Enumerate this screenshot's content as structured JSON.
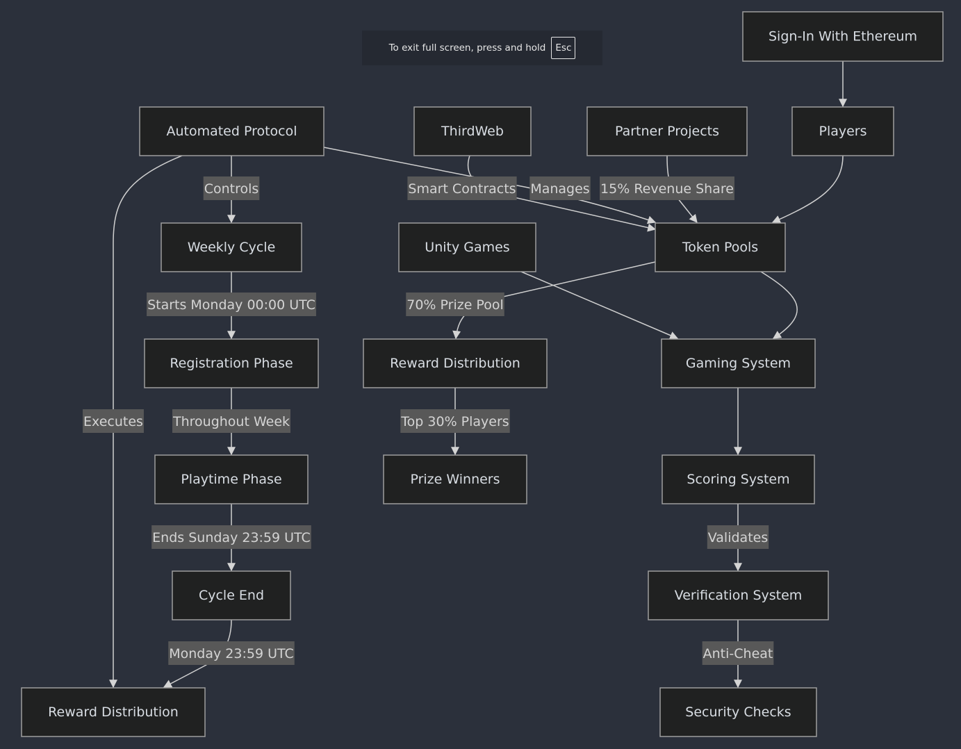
{
  "fullscreen_notice": {
    "message": "To exit full screen, press and hold",
    "key": "Esc"
  },
  "colors": {
    "background": "#2b303b",
    "node_fill": "#202121",
    "node_border": "#9e9e9e",
    "node_text": "#d8dde3",
    "edge": "#d0d0d0",
    "edge_label_bg": "#585858",
    "edge_label_text": "#d4d4d4"
  },
  "nodes": [
    {
      "id": "siwe",
      "label": "Sign-In With Ethereum"
    },
    {
      "id": "auto",
      "label": "Automated Protocol"
    },
    {
      "id": "thirdweb",
      "label": "ThirdWeb"
    },
    {
      "id": "partners",
      "label": "Partner Projects"
    },
    {
      "id": "players",
      "label": "Players"
    },
    {
      "id": "weekly",
      "label": "Weekly Cycle"
    },
    {
      "id": "unity",
      "label": "Unity Games"
    },
    {
      "id": "pools",
      "label": "Token Pools"
    },
    {
      "id": "registration",
      "label": "Registration Phase"
    },
    {
      "id": "reward_mid",
      "label": "Reward Distribution"
    },
    {
      "id": "gaming",
      "label": "Gaming System"
    },
    {
      "id": "playtime",
      "label": "Playtime Phase"
    },
    {
      "id": "winners",
      "label": "Prize Winners"
    },
    {
      "id": "scoring",
      "label": "Scoring System"
    },
    {
      "id": "cycle_end",
      "label": "Cycle End"
    },
    {
      "id": "verification",
      "label": "Verification System"
    },
    {
      "id": "reward_bottom",
      "label": "Reward Distribution"
    },
    {
      "id": "security",
      "label": "Security Checks"
    }
  ],
  "edges": [
    {
      "from": "siwe",
      "to": "players",
      "label": ""
    },
    {
      "from": "auto",
      "to": "weekly",
      "label": "Controls"
    },
    {
      "from": "auto",
      "to": "reward_bottom",
      "label": "Executes"
    },
    {
      "from": "auto",
      "to": "pools",
      "label": "Manages"
    },
    {
      "from": "thirdweb",
      "to": "pools",
      "label": "Smart Contracts"
    },
    {
      "from": "partners",
      "to": "pools",
      "label": "15% Revenue Share"
    },
    {
      "from": "players",
      "to": "pools",
      "label": ""
    },
    {
      "from": "weekly",
      "to": "registration",
      "label": "Starts Monday 00:00 UTC"
    },
    {
      "from": "pools",
      "to": "reward_mid",
      "label": "70% Prize Pool"
    },
    {
      "from": "unity",
      "to": "gaming",
      "label": ""
    },
    {
      "from": "pools",
      "to": "gaming",
      "label": ""
    },
    {
      "from": "registration",
      "to": "playtime",
      "label": "Throughout Week"
    },
    {
      "from": "reward_mid",
      "to": "winners",
      "label": "Top 30% Players"
    },
    {
      "from": "gaming",
      "to": "scoring",
      "label": ""
    },
    {
      "from": "playtime",
      "to": "cycle_end",
      "label": "Ends Sunday 23:59 UTC"
    },
    {
      "from": "scoring",
      "to": "verification",
      "label": "Validates"
    },
    {
      "from": "cycle_end",
      "to": "reward_bottom",
      "label": "Monday 23:59 UTC"
    },
    {
      "from": "verification",
      "to": "security",
      "label": "Anti-Cheat"
    }
  ]
}
